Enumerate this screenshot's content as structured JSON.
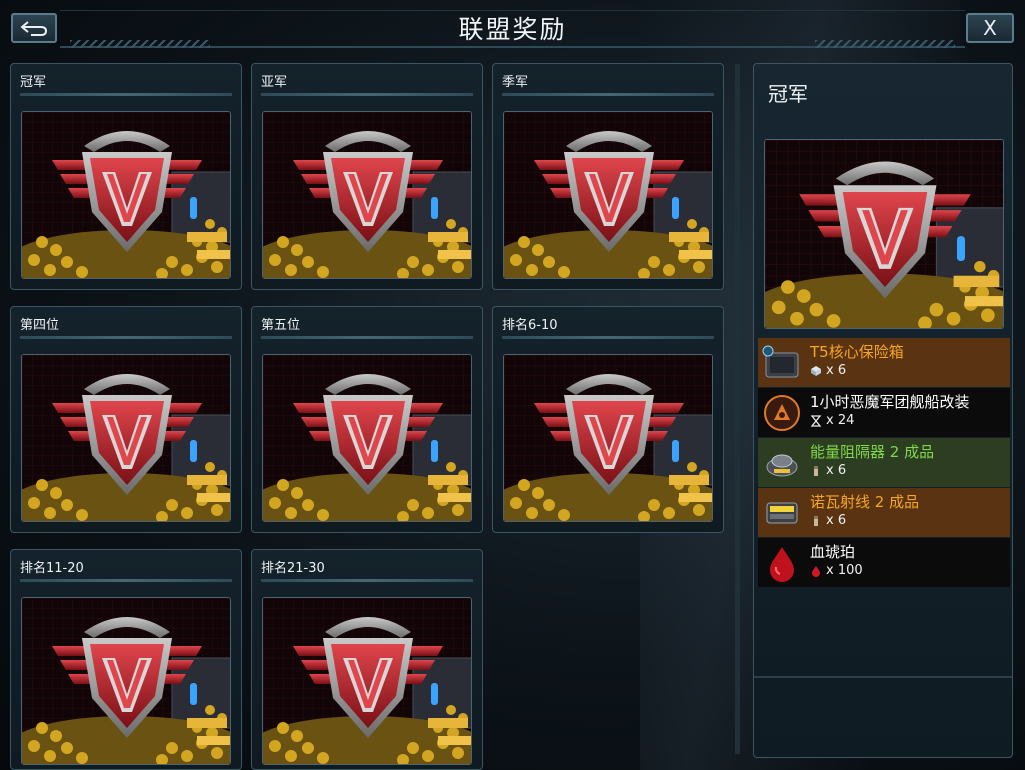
{
  "header": {
    "title": "联盟奖励",
    "back_icon": "back-arrow-icon",
    "close_label": "X"
  },
  "rewards": [
    {
      "label": "冠军"
    },
    {
      "label": "亚军"
    },
    {
      "label": "季军"
    },
    {
      "label": "第四位"
    },
    {
      "label": "第五位"
    },
    {
      "label": "排名6-10"
    },
    {
      "label": "排名11-20"
    },
    {
      "label": "排名21-30"
    }
  ],
  "detail": {
    "title": "冠军",
    "items": [
      {
        "name": "T5核心保险箱",
        "qty": "x 6",
        "name_color": "#f5a623",
        "bg": "#5a3412",
        "icon": "safe-box-icon",
        "qty_icon": "cube-icon"
      },
      {
        "name": "1小时恶魔军团舰船改装",
        "qty": "x 24",
        "name_color": "#ffffff",
        "bg": "#0b0b0b",
        "icon": "demon-legion-icon",
        "qty_icon": "hourglass-icon"
      },
      {
        "name": "能量阻隔器 2 成品",
        "qty": "x 6",
        "name_color": "#7fd84a",
        "bg": "#2d3d22",
        "icon": "energy-blocker-icon",
        "qty_icon": "component-icon"
      },
      {
        "name": "诺瓦射线 2 成品",
        "qty": "x 6",
        "name_color": "#f5a623",
        "bg": "#5a3412",
        "icon": "nova-ray-icon",
        "qty_icon": "component-icon"
      },
      {
        "name": "血琥珀",
        "qty": "x 100",
        "name_color": "#ffffff",
        "bg": "#0b0b0b",
        "icon": "blood-amber-icon",
        "qty_icon": "blood-drop-icon"
      }
    ]
  },
  "colors": {
    "accent": "#c2303a",
    "frame": "#3b5563"
  }
}
